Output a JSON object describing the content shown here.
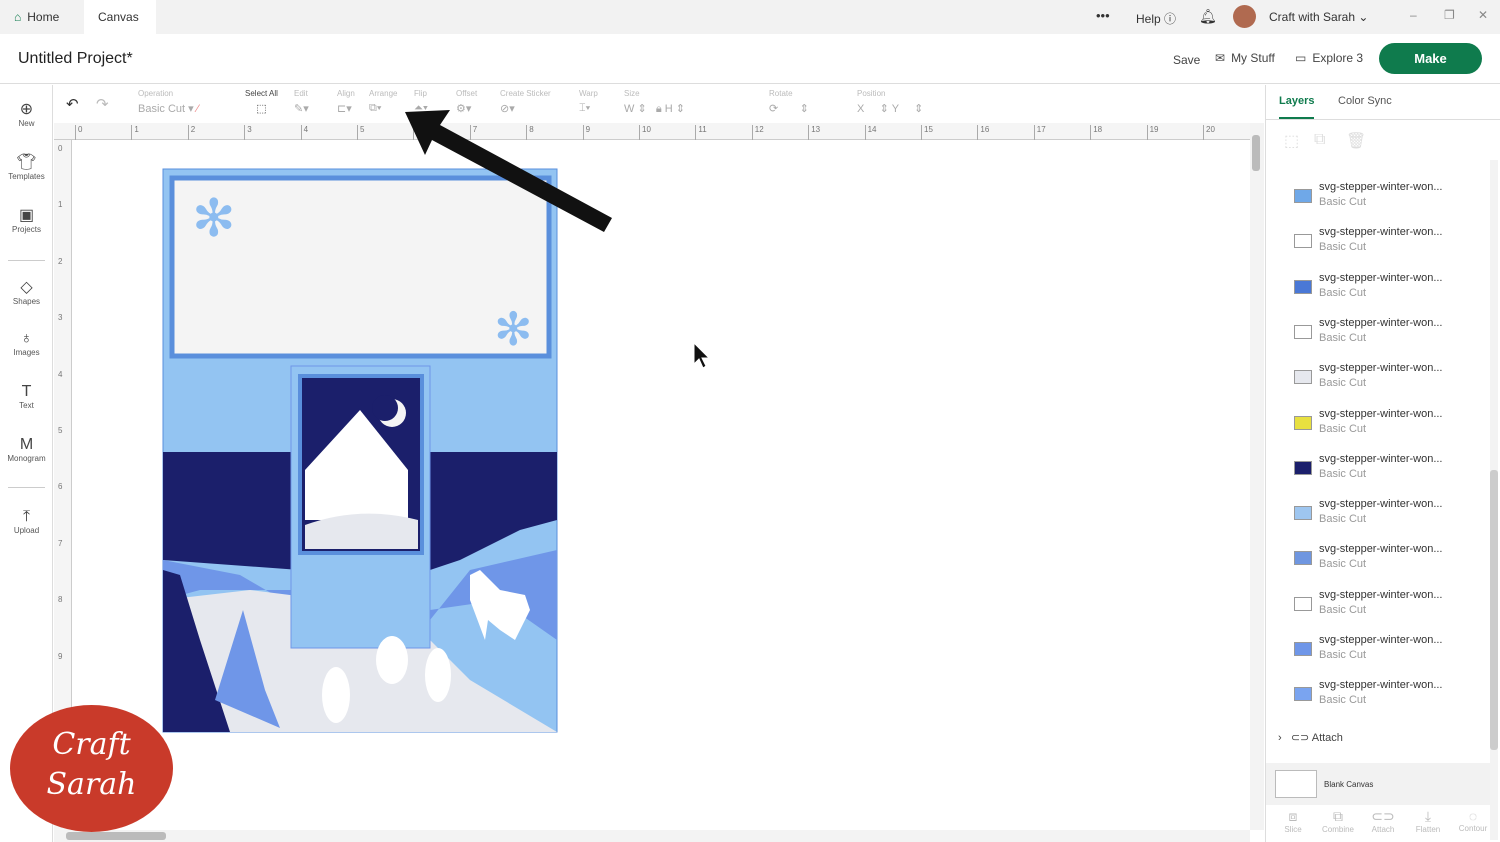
{
  "tabs": [
    {
      "label": "Home"
    },
    {
      "label": "Canvas"
    }
  ],
  "topbar": {
    "more": "•••",
    "help": "Help",
    "user": "Craft with Sarah"
  },
  "header": {
    "title": "Untitled Project*",
    "save": "Save",
    "my_stuff": "My Stuff",
    "machine": "Explore 3",
    "make": "Make"
  },
  "sidebar": [
    {
      "label": "New",
      "icon": "plus-circle-icon"
    },
    {
      "label": "Templates",
      "icon": "shirt-icon"
    },
    {
      "label": "Projects",
      "icon": "projects-icon"
    },
    {
      "label": "Shapes",
      "icon": "shapes-icon"
    },
    {
      "label": "Images",
      "icon": "bulb-icon"
    },
    {
      "label": "Text",
      "icon": "text-icon"
    },
    {
      "label": "Monogram",
      "icon": "monogram-icon"
    },
    {
      "label": "Upload",
      "icon": "upload-icon"
    }
  ],
  "toolbar": {
    "operation": "Operation",
    "operation_value": "Basic Cut",
    "select_all": "Select All",
    "edit": "Edit",
    "align": "Align",
    "arrange": "Arrange",
    "flip": "Flip",
    "offset": "Offset",
    "create_sticker": "Create Sticker",
    "warp": "Warp",
    "size": "Size",
    "w": "W",
    "h": "H",
    "rotate": "Rotate",
    "position": "Position",
    "x": "X",
    "y": "Y"
  },
  "ruler_top": [
    "0",
    "1",
    "2",
    "3",
    "4",
    "5",
    "6",
    "7",
    "8",
    "9",
    "10",
    "11",
    "12",
    "13",
    "14",
    "15",
    "16",
    "17",
    "18",
    "19",
    "20"
  ],
  "ruler_left": [
    "0",
    "1",
    "2",
    "3",
    "4",
    "5",
    "6",
    "7",
    "8",
    "9"
  ],
  "panel": {
    "tabs": [
      "Layers",
      "Color Sync"
    ],
    "layers": [
      {
        "name": "svg-stepper-winter-won...",
        "op": "Basic Cut",
        "color": "#6fa8e8"
      },
      {
        "name": "svg-stepper-winter-won...",
        "op": "Basic Cut",
        "color": "#ffffff"
      },
      {
        "name": "svg-stepper-winter-won...",
        "op": "Basic Cut",
        "color": "#4a78d6"
      },
      {
        "name": "svg-stepper-winter-won...",
        "op": "Basic Cut",
        "color": "#ffffff"
      },
      {
        "name": "svg-stepper-winter-won...",
        "op": "Basic Cut",
        "color": "#e6e8ee"
      },
      {
        "name": "svg-stepper-winter-won...",
        "op": "Basic Cut",
        "color": "#e8e040"
      },
      {
        "name": "svg-stepper-winter-won...",
        "op": "Basic Cut",
        "color": "#1b1f6b"
      },
      {
        "name": "svg-stepper-winter-won...",
        "op": "Basic Cut",
        "color": "#9ec6f0"
      },
      {
        "name": "svg-stepper-winter-won...",
        "op": "Basic Cut",
        "color": "#6f96e0"
      },
      {
        "name": "svg-stepper-winter-won...",
        "op": "Basic Cut",
        "color": "#ffffff"
      },
      {
        "name": "svg-stepper-winter-won...",
        "op": "Basic Cut",
        "color": "#6f96e8"
      },
      {
        "name": "svg-stepper-winter-won...",
        "op": "Basic Cut",
        "color": "#7aa4f0"
      }
    ],
    "attach": "Attach",
    "blank_canvas": "Blank Canvas",
    "bottom": [
      "Slice",
      "Combine",
      "Attach",
      "Flatten",
      "Contour"
    ]
  },
  "watermark": "Craft with Sarah"
}
